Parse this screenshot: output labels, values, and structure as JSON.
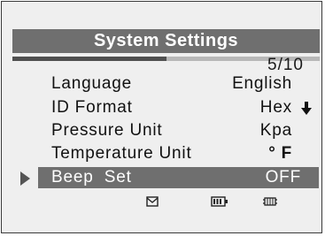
{
  "header": {
    "title": "System Settings"
  },
  "pagination": {
    "current": 5,
    "total": 10,
    "label": "5/10",
    "progress_fraction": 0.5
  },
  "menu": {
    "items": [
      {
        "label": "Language",
        "value": "English"
      },
      {
        "label": "ID Format",
        "value": "Hex",
        "indicator": "arrow-down-icon"
      },
      {
        "label": "Pressure Unit",
        "value": "Kpa"
      },
      {
        "label": "Temperature Unit",
        "value_symbol": "°",
        "value": "F"
      },
      {
        "label": "Beep  Set",
        "value": "OFF",
        "selected": true
      }
    ]
  },
  "status_bar": {
    "icons": [
      "envelope-icon",
      "battery-icon",
      "vehicle-connection-icon"
    ]
  },
  "colors": {
    "title_bar": "#6f6f6f",
    "selected_row": "#6f6f6f",
    "background": "#efefef",
    "progress_fill": "#505050",
    "progress_track": "#b8b8b8"
  }
}
